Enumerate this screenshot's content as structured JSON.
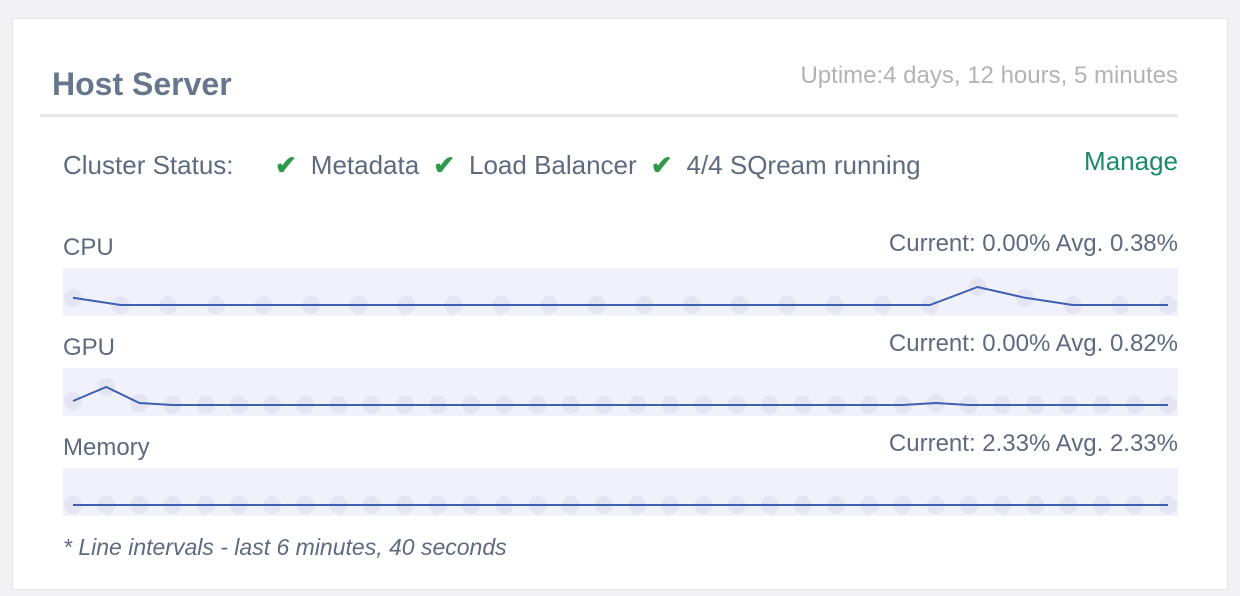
{
  "header": {
    "title": "Host Server",
    "uptime": "Uptime:4 days, 12 hours, 5 minutes"
  },
  "cluster": {
    "label": "Cluster Status:",
    "items": [
      {
        "icon": "check-icon",
        "label": "Metadata"
      },
      {
        "icon": "check-icon",
        "label": "Load Balancer"
      },
      {
        "icon": "check-icon",
        "label": "4/4 SQream running"
      }
    ],
    "manage_label": "Manage"
  },
  "metrics": [
    {
      "name": "CPU",
      "stats": "Current: 0.00% Avg. 0.38%",
      "values": [
        0.04,
        0,
        0,
        0,
        0,
        0,
        0,
        0,
        0,
        0,
        0,
        0,
        0,
        0,
        0,
        0,
        0,
        0,
        0,
        0.1,
        0.04,
        0,
        0,
        0
      ]
    },
    {
      "name": "GPU",
      "stats": "Current: 0.00% Avg. 0.82%",
      "values": [
        0.1,
        0.45,
        0.05,
        0,
        0,
        0,
        0,
        0,
        0,
        0,
        0,
        0,
        0,
        0,
        0,
        0,
        0,
        0,
        0,
        0,
        0,
        0,
        0,
        0,
        0,
        0,
        0.05,
        0,
        0,
        0,
        0,
        0,
        0,
        0
      ]
    },
    {
      "name": "Memory",
      "stats": "Current: 2.33% Avg. 2.33%",
      "values": [
        2.33,
        2.33,
        2.33,
        2.33,
        2.33,
        2.33,
        2.33,
        2.33,
        2.33,
        2.33,
        2.33,
        2.33,
        2.33,
        2.33,
        2.33,
        2.33,
        2.33,
        2.33,
        2.33,
        2.33,
        2.33,
        2.33,
        2.33,
        2.33,
        2.33,
        2.33,
        2.33,
        2.33,
        2.33,
        2.33,
        2.33,
        2.33,
        2.33,
        2.33
      ]
    }
  ],
  "footnote": "* Line intervals - last 6 minutes, 40 seconds",
  "colors": {
    "title": "#66768c",
    "check": "#2e9a47",
    "manage": "#1b8a6b",
    "line": "#3f5fb0",
    "dot": "#e4e4f3",
    "spark_bg": "#f1f1fb"
  }
}
